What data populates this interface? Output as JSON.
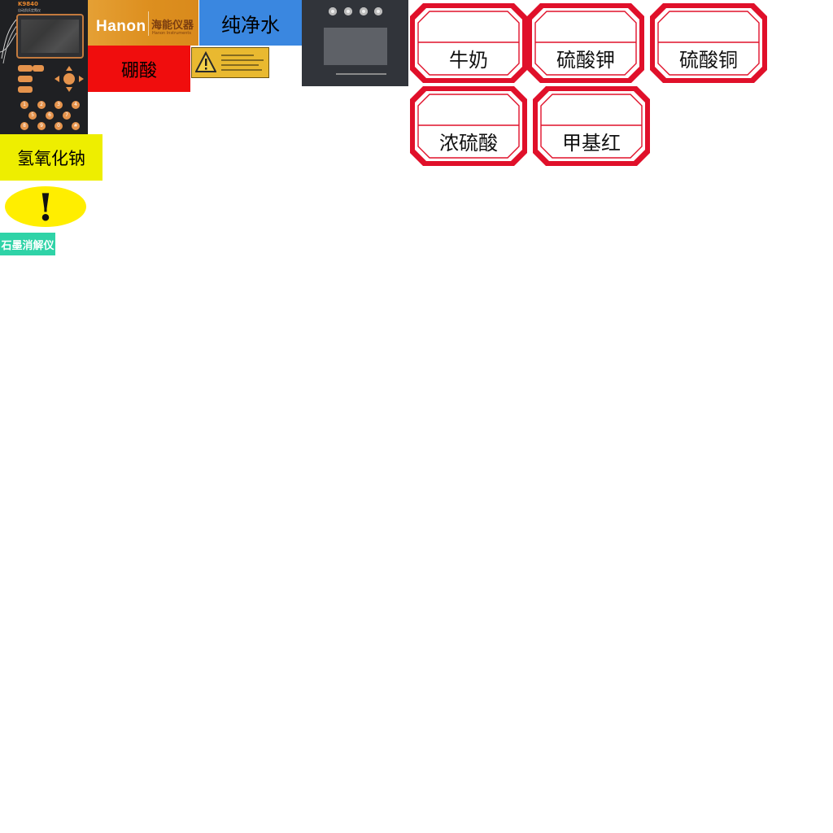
{
  "device": {
    "model": "K9840",
    "subtitle": "自动凯氏定氮仪",
    "keys": [
      "1",
      "2",
      "3",
      "4",
      "5",
      "6",
      "7",
      "8",
      "9",
      "0",
      "#"
    ],
    "accent_color": "#e5934c"
  },
  "logo_plate": {
    "brand": "anon",
    "brand_initial": "H",
    "name_cn": "海能仪器",
    "name_en": "Hanon Instruments"
  },
  "labels": {
    "water": "纯净水",
    "boric_acid": "硼酸",
    "sodium_hydroxide": "氢氧化钠",
    "graphite_digester": "石墨消解仪"
  },
  "warning": {
    "mark": "!",
    "color": "#ffee00"
  },
  "tags": [
    {
      "text": "牛奶"
    },
    {
      "text": "硫酸钾"
    },
    {
      "text": "硫酸铜"
    },
    {
      "text": "浓硫酸"
    },
    {
      "text": "甲基红"
    }
  ],
  "colors": {
    "tag_red": "#e0102a",
    "water_blue": "#3a87e0",
    "boric_red": "#f00d0d",
    "naoh_yellow": "#eeee00",
    "graphite_teal": "#2fd3a7"
  }
}
